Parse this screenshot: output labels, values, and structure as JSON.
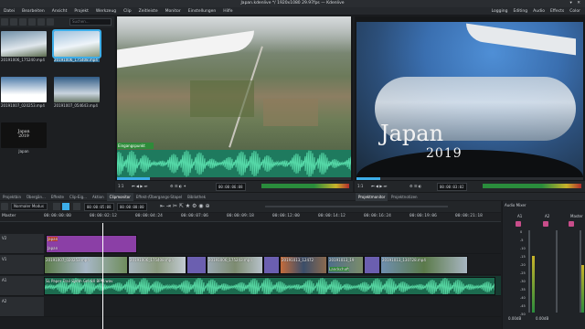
{
  "window": {
    "title": "Japan.kdenlive */ 1920x1080 29.97fps — Kdenlive",
    "controls": "▾ ✕"
  },
  "menu": [
    "Datei",
    "Bearbeiten",
    "Ansicht",
    "Projekt",
    "Werkzeug",
    "Clip",
    "Zeitleiste",
    "Monitor",
    "Einstellungen",
    "Hilfe"
  ],
  "layouts": [
    "Logging",
    "Editing",
    "Audio",
    "Effects",
    "Color"
  ],
  "search": {
    "placeholder": "Suchen..."
  },
  "bin_clips": [
    {
      "label": "20191006_175240.mp4",
      "colors": [
        "#6f8fa8",
        "#dfe6ec"
      ],
      "selected": false
    },
    {
      "label": "20191006_175408.mp4",
      "colors": [
        "#9fc1dc",
        "#eef4f9"
      ],
      "selected": true
    },
    {
      "label": "20191007_020253.mp4",
      "colors": [
        "#4c7aa8",
        "#ffffff"
      ],
      "selected": false
    },
    {
      "label": "20191007_054643.mp4",
      "colors": [
        "#305c86",
        "#c9d4de"
      ],
      "selected": false
    },
    {
      "label": "Japan",
      "thumb_text": [
        "Japan",
        "2019"
      ],
      "colors": [
        "#111111",
        "#111111"
      ],
      "selected": false
    }
  ],
  "clip_monitor": {
    "marker_label": "Eingangspunkt",
    "zoom": "1:1",
    "timecode": "00:00:06:08"
  },
  "project_monitor": {
    "overlay_title": "Japan",
    "overlay_subtitle": "2019",
    "zoom": "1:1",
    "timecode": "00:00:03:02"
  },
  "bottom_tabs": [
    "Projektbin",
    "Übergän...",
    "Effekte",
    "Clip-Eig...",
    "Aktion",
    "Clipmonitor",
    "Effekt-/Übergangs-Stapel",
    "Bibliothek",
    "Projektmonitor",
    "Projektnotizen"
  ],
  "active_tabs": [
    "Clipmonitor",
    "Projektmonitor"
  ],
  "timeline_toolbar": {
    "mode": "Normaler Modus",
    "position": "00:00:05:08",
    "duration": "00:00:00:00"
  },
  "ruler_ticks": [
    "00:00:00:00",
    "00:00:02:12",
    "00:00:04:24",
    "00:00:07:06",
    "00:00:09:18",
    "00:00:12:00",
    "00:00:14:12",
    "00:00:16:24",
    "00:00:19:06",
    "00:00:21:18"
  ],
  "tracks": {
    "master_label": "Master",
    "v2": {
      "name": "V2",
      "clips": [
        {
          "name": "Japan",
          "sub": "Japan"
        }
      ]
    },
    "v1": {
      "name": "V1",
      "clips": [
        {
          "name": "20191007_020253.mp4"
        },
        {
          "name": "20191006_175408.mp4"
        },
        {
          "name": "20191006_175243.mp4"
        },
        {
          "name": "20191013_12472"
        },
        {
          "name": "20191013_19"
        },
        {
          "name": "20191013_130728.mp4"
        }
      ],
      "subtitle_marker": "Landschaft"
    },
    "a1": {
      "name": "A1",
      "clips": [
        {
          "name": "SL Paper Trail Synth Gm 80 BPM.wav"
        }
      ]
    },
    "a2": {
      "name": "A2"
    }
  },
  "mixer": {
    "title": "Audio Mixer",
    "channels": [
      "A1",
      "A2",
      "Master"
    ],
    "db_marks": [
      "0",
      "-5",
      "-10",
      "-15",
      "-20",
      "-25",
      "-30",
      "-35",
      "-40",
      "-45",
      "-50"
    ],
    "readouts": [
      "0.00dB",
      "0.00dB"
    ]
  },
  "accent": "#3daee9"
}
